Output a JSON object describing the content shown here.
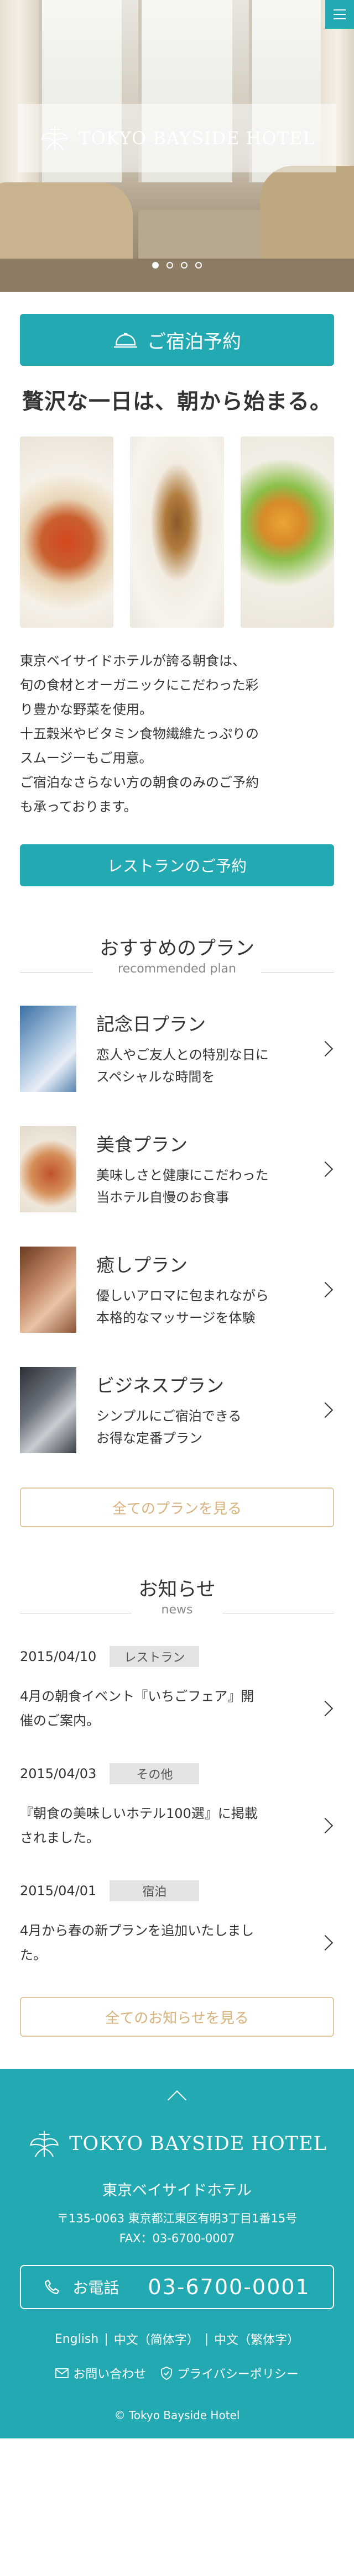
{
  "hero": {
    "logo_text": "TOKYO BAYSIDE HOTEL",
    "slides": [
      true,
      false,
      false,
      false
    ]
  },
  "reserve_button": "ご宿泊予約",
  "tagline": "贅沢な一日は、朝から始まる。",
  "intro_lines": [
    "東京ベイサイドホテルが誇る朝食は、",
    "旬の食材とオーガニックにこだわった彩",
    "り豊かな野菜を使用。",
    "十五穀米やビタミン食物繊維たっぷりの",
    "スムージーもご用意。",
    "ご宿泊なさらない方の朝食のみのご予約",
    "も承っております。"
  ],
  "restaurant_button": "レストランのご予約",
  "plans_section": {
    "title": "おすすめのプラン",
    "subtitle": "recommended plan",
    "items": [
      {
        "title": "記念日プラン",
        "desc": [
          "恋人やご友人との特別な日に",
          "スペシャルな時間を"
        ]
      },
      {
        "title": "美食プラン",
        "desc": [
          "美味しさと健康にこだわった",
          "当ホテル自慢のお食事"
        ]
      },
      {
        "title": "癒しプラン",
        "desc": [
          "優しいアロマに包まれながら",
          "本格的なマッサージを体験"
        ]
      },
      {
        "title": "ビジネスプラン",
        "desc": [
          "シンプルにご宿泊できる",
          "お得な定番プラン"
        ]
      }
    ],
    "all_button": "全てのプランを見る"
  },
  "news_section": {
    "title": "お知らせ",
    "subtitle": "news",
    "items": [
      {
        "date": "2015/04/10",
        "category": "レストラン",
        "text": [
          "4月の朝食イベント『いちごフェア』開",
          "催のご案内。"
        ]
      },
      {
        "date": "2015/04/03",
        "category": "その他",
        "text": [
          "『朝食の美味しいホテル100選』に掲載",
          "されました。"
        ]
      },
      {
        "date": "2015/04/01",
        "category": "宿泊",
        "text": [
          "4月から春の新プランを追加いたしまし",
          "た。"
        ]
      }
    ],
    "all_button": "全てのお知らせを見る"
  },
  "footer": {
    "logo_text": "TOKYO BAYSIDE HOTEL",
    "hotel_name": "東京ベイサイドホテル",
    "address": "〒135-0063 東京都江東区有明3丁目1番15号",
    "fax": "FAX：03-6700-0007",
    "tel_label": "お電話",
    "tel_number": "03-6700-0001",
    "languages": [
      "English",
      "中文（简体字）",
      "中文（繁体字）"
    ],
    "contact_label": "お問い合わせ",
    "privacy_label": "プライバシーポリシー",
    "copyright": "© Tokyo Bayside Hotel"
  },
  "colors": {
    "teal": "#23a9b2",
    "gold": "#d8b27c"
  }
}
